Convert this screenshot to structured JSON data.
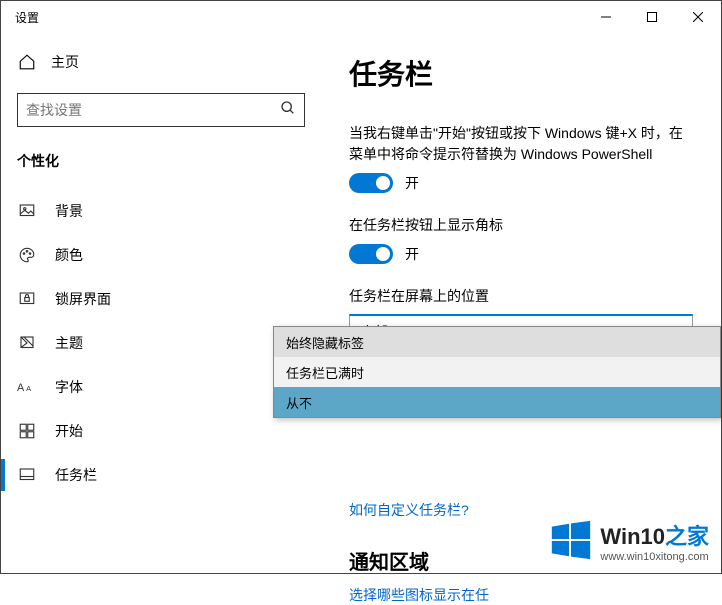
{
  "window": {
    "title": "设置"
  },
  "sidebar": {
    "home": "主页",
    "search_placeholder": "查找设置",
    "category": "个性化",
    "items": [
      {
        "label": "背景"
      },
      {
        "label": "颜色"
      },
      {
        "label": "锁屏界面"
      },
      {
        "label": "主题"
      },
      {
        "label": "字体"
      },
      {
        "label": "开始"
      },
      {
        "label": "任务栏"
      }
    ]
  },
  "content": {
    "heading": "任务栏",
    "powershell_desc": "当我右键单击\"开始\"按钮或按下 Windows 键+X 时，在菜单中将命令提示符替换为 Windows PowerShell",
    "on_label": "开",
    "badges_label": "在任务栏按钮上显示角标",
    "position_label": "任务栏在屏幕上的位置",
    "position_value": "底部",
    "combine_options": [
      "始终隐藏标签",
      "任务栏已满时",
      "从不"
    ],
    "customize_link": "如何自定义任务栏?",
    "notification_heading": "通知区域",
    "notification_link": "选择哪些图标显示在任"
  },
  "watermark": {
    "brand1": "Win10",
    "brand2": "之家",
    "url": "www.win10xitong.com"
  }
}
